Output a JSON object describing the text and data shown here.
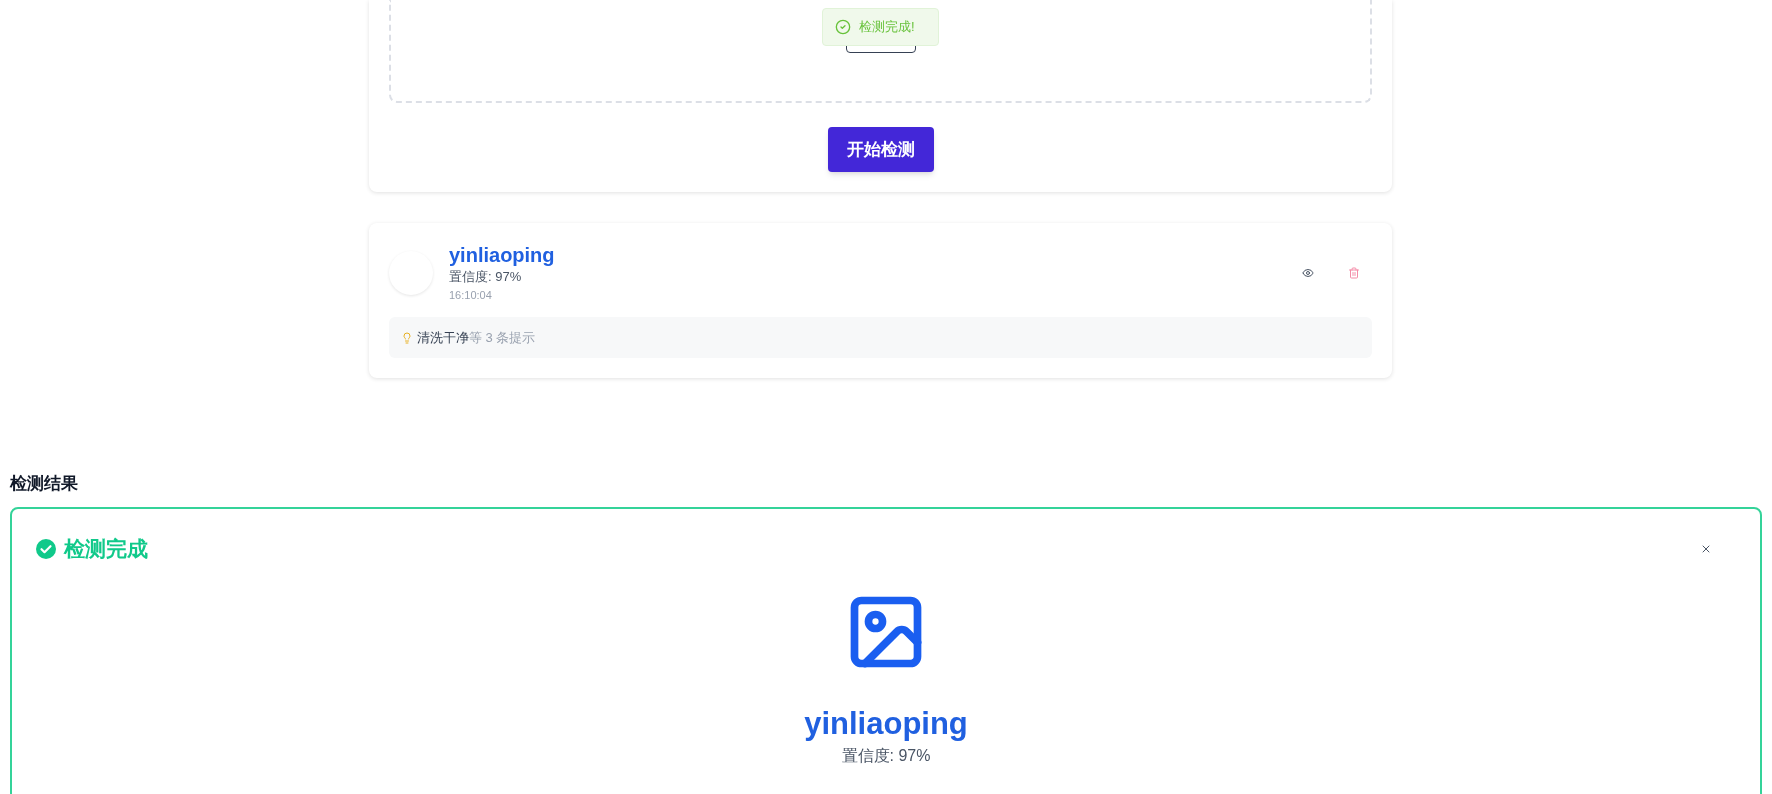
{
  "upload": {
    "start_button": "开始检测"
  },
  "toast": {
    "kind": "success",
    "text": "检测完成!"
  },
  "history": [
    {
      "name": "yinliaoping",
      "confidence": "置信度: 97%",
      "time": "16:10:04",
      "tip_highlight": "清洗干净",
      "tip_rest": "等 3 条提示"
    }
  ],
  "result_section": {
    "heading": "检测结果",
    "status": "检测完成",
    "name": "yinliaoping",
    "confidence": "置信度: 97%"
  }
}
